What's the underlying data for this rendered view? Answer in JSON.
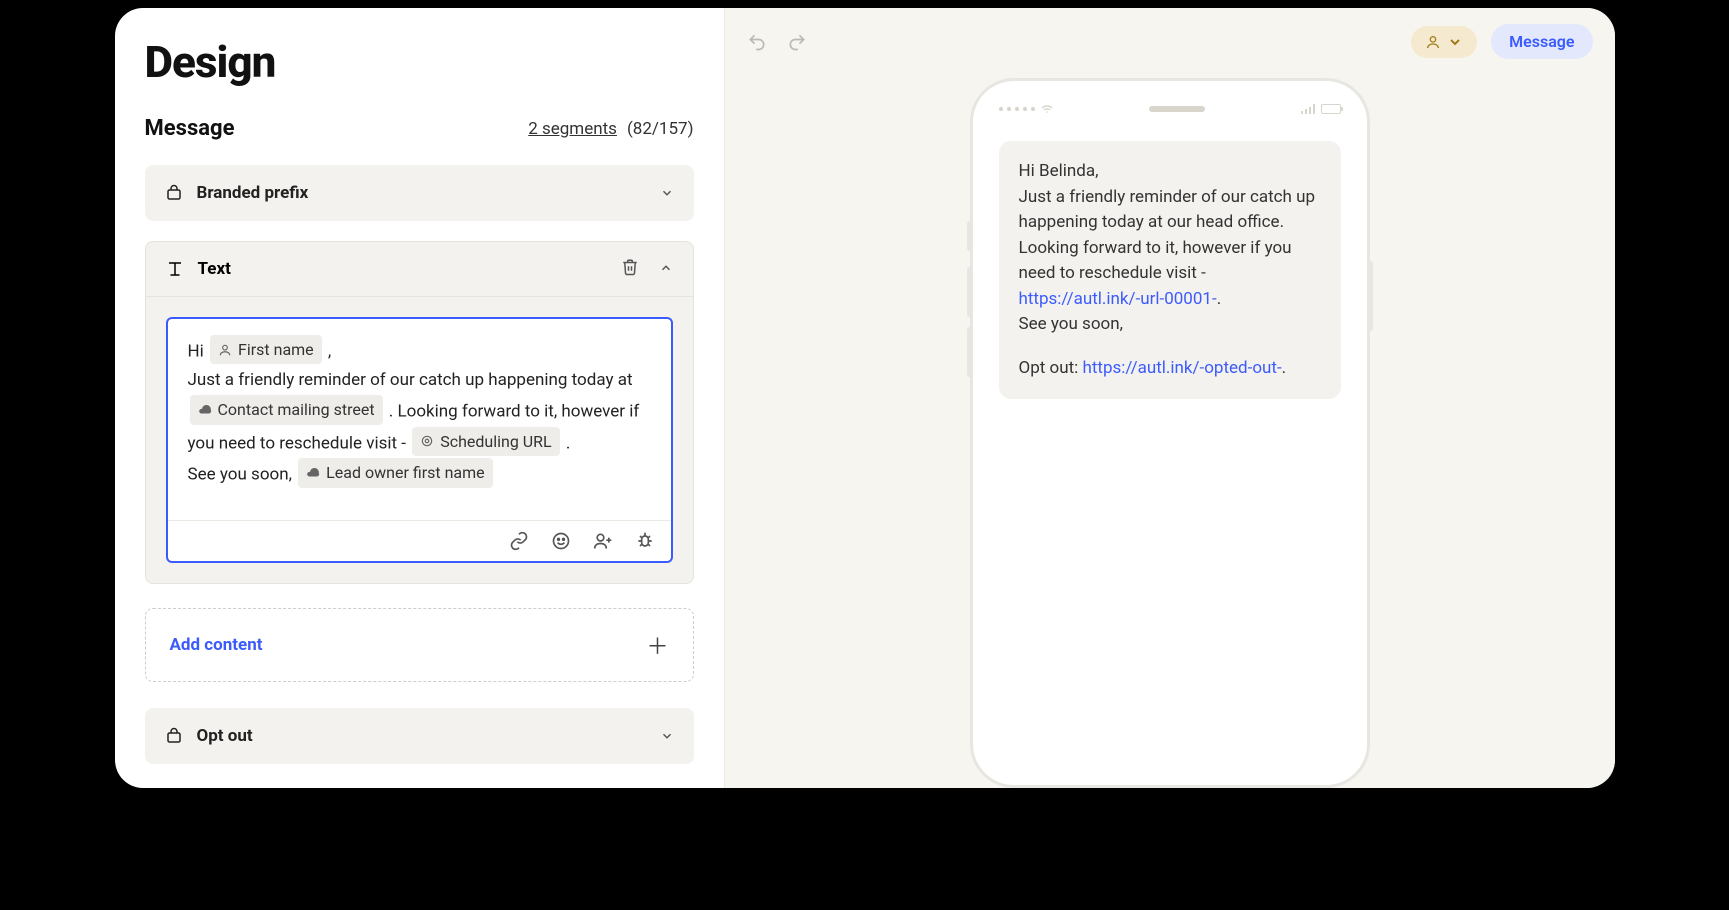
{
  "page": {
    "title": "Design"
  },
  "section": {
    "title": "Message",
    "segments_label": "2 segments",
    "counter": "(82/157)"
  },
  "accordion": {
    "branded_prefix": "Branded prefix",
    "text": "Text",
    "opt_out": "Opt out",
    "add_content": "Add content"
  },
  "editor": {
    "hi": "Hi",
    "comma": ",",
    "line2": "Just a friendly reminder of our catch up happening today at",
    "period_after_street": ". Looking forward to it, however if you need to reschedule visit -",
    "period_end": ".",
    "see_you": "See you soon,",
    "tokens": {
      "first_name": "First name",
      "mailing_street": "Contact mailing street",
      "scheduling_url": "Scheduling URL",
      "lead_owner": "Lead owner first name"
    }
  },
  "preview": {
    "tab_label": "Message",
    "line1": "Hi Belinda,",
    "line2": "Just a friendly reminder of our catch up happening today at our head office. Looking forward to it, however if you need to reschedule visit - ",
    "url1": "https://autl.ink/-url-00001-",
    "line3": "See you soon,",
    "optout_prefix": "Opt out: ",
    "url2": "https://autl.ink/-opted-out-",
    "dot": "."
  }
}
